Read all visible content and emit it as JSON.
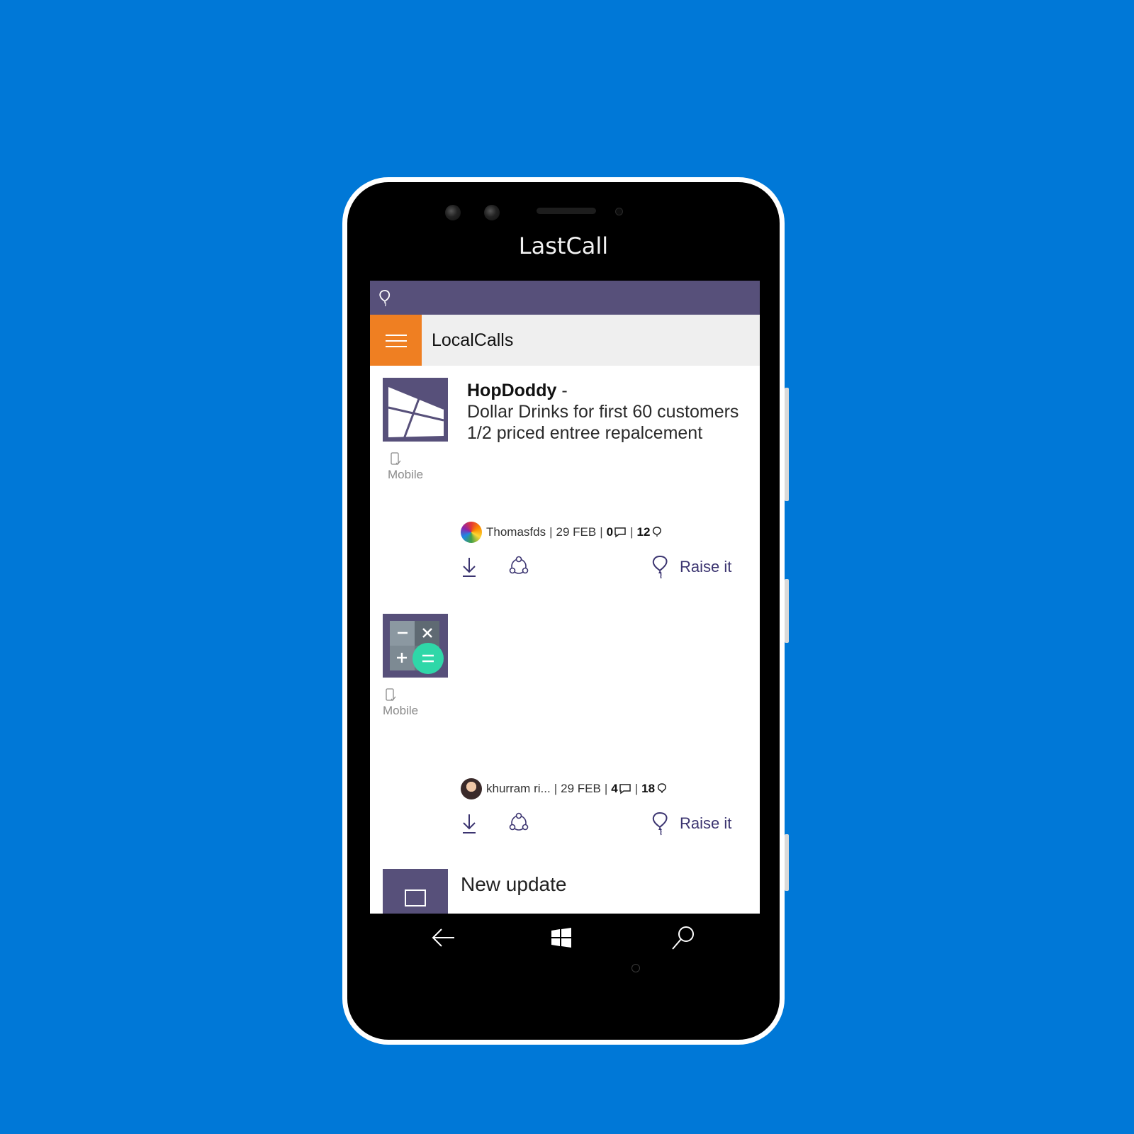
{
  "device": {
    "brand_text": "LastCall"
  },
  "app": {
    "title": "LocalCalls",
    "colors": {
      "status_bar": "#57507A",
      "menu_button": "#EF7F22",
      "accent": "#3b3470"
    },
    "status_icon": "balloon-icon",
    "menu_icon": "hamburger-icon"
  },
  "feed": [
    {
      "store": "HopDoddy",
      "dash": " -",
      "lines": [
        "Dollar Drinks for first 60 customers",
        "1/2 priced entree repalcement"
      ],
      "platform": "Mobile",
      "thumbnail_icon": "window-tile-icon",
      "author": "Thomasfds",
      "date": "29 FEB",
      "comments": "0",
      "raises": "12",
      "raise_label": "Raise it"
    },
    {
      "store": "",
      "lines": [],
      "platform": "Mobile",
      "thumbnail_icon": "calculator-icon",
      "author": "khurram ri...",
      "date": "29 FEB",
      "comments": "4",
      "raises": "18",
      "raise_label": "Raise it"
    },
    {
      "title": "New update"
    }
  ],
  "nav": {
    "items": [
      "back-arrow-icon",
      "windows-start-icon",
      "search-icon"
    ]
  }
}
